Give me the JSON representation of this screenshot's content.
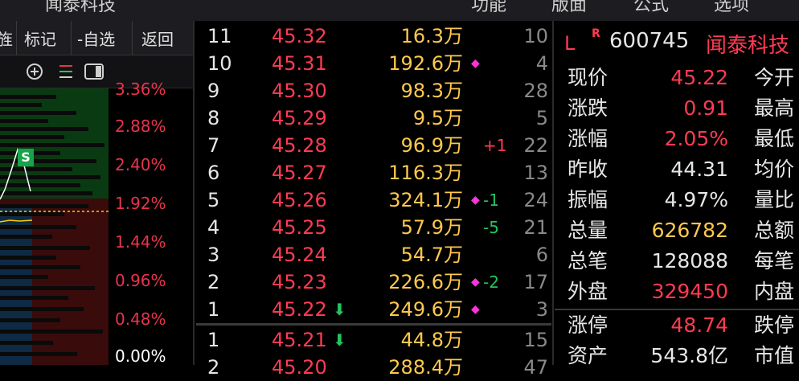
{
  "window": {
    "title": "闻泰科技",
    "menu": [
      "功能",
      "版面",
      "公式",
      "选项"
    ]
  },
  "toolbar": {
    "items": [
      "旌",
      "标记",
      "-自选",
      "返回"
    ]
  },
  "chart": {
    "signal_label": "S",
    "percent_ticks": [
      "3.36%",
      "2.88%",
      "2.40%",
      "1.92%",
      "1.44%",
      "0.96%",
      "0.48%",
      "0.00%"
    ]
  },
  "order_book": {
    "asks": [
      {
        "level": "11",
        "price": "45.32",
        "volume": "16.3万",
        "change": "",
        "count": "10",
        "marker": false,
        "arrow": false
      },
      {
        "level": "10",
        "price": "45.31",
        "volume": "192.6万",
        "change": "",
        "count": "4",
        "marker": true,
        "arrow": false
      },
      {
        "level": "9",
        "price": "45.30",
        "volume": "98.3万",
        "change": "",
        "count": "28",
        "marker": false,
        "arrow": false
      },
      {
        "level": "8",
        "price": "45.29",
        "volume": "9.5万",
        "change": "",
        "count": "5",
        "marker": false,
        "arrow": false
      },
      {
        "level": "7",
        "price": "45.28",
        "volume": "96.9万",
        "change": "+1",
        "count": "22",
        "marker": false,
        "arrow": false
      },
      {
        "level": "6",
        "price": "45.27",
        "volume": "116.3万",
        "change": "",
        "count": "13",
        "marker": false,
        "arrow": false
      },
      {
        "level": "5",
        "price": "45.26",
        "volume": "324.1万",
        "change": "-1",
        "count": "24",
        "marker": true,
        "arrow": false
      },
      {
        "level": "4",
        "price": "45.25",
        "volume": "57.9万",
        "change": "-5",
        "count": "21",
        "marker": false,
        "arrow": false
      },
      {
        "level": "3",
        "price": "45.24",
        "volume": "54.7万",
        "change": "",
        "count": "6",
        "marker": false,
        "arrow": false
      },
      {
        "level": "2",
        "price": "45.23",
        "volume": "226.6万",
        "change": "-2",
        "count": "17",
        "marker": true,
        "arrow": false
      },
      {
        "level": "1",
        "price": "45.22",
        "volume": "249.6万",
        "change": "",
        "count": "3",
        "marker": true,
        "arrow": true
      }
    ],
    "bids": [
      {
        "level": "1",
        "price": "45.21",
        "volume": "44.8万",
        "change": "",
        "count": "15",
        "marker": false,
        "arrow": true
      },
      {
        "level": "2",
        "price": "45.20",
        "volume": "288.4万",
        "change": "",
        "count": "47",
        "marker": false,
        "arrow": false
      }
    ],
    "colors": {
      "price": "#ff3b52",
      "volume": "#ffc94d",
      "marker": "#ff33d8",
      "down": "#22c55e"
    }
  },
  "quote": {
    "badge_l": "L",
    "badge_r": "R",
    "code": "600745",
    "name": "闻泰科技",
    "rows": [
      {
        "label": "现价",
        "value": "45.22",
        "color": "red",
        "label2": "今开"
      },
      {
        "label": "涨跌",
        "value": "0.91",
        "color": "red",
        "label2": "最高"
      },
      {
        "label": "涨幅",
        "value": "2.05%",
        "color": "red",
        "label2": "最低"
      },
      {
        "label": "昨收",
        "value": "44.31",
        "color": "white",
        "label2": "均价"
      },
      {
        "label": "振幅",
        "value": "4.97%",
        "color": "white",
        "label2": "量比"
      },
      {
        "label": "总量",
        "value": "626782",
        "color": "yellow",
        "label2": "总额"
      },
      {
        "label": "总笔",
        "value": "128088",
        "color": "white",
        "label2": "每笔"
      },
      {
        "label": "外盘",
        "value": "329450",
        "color": "red",
        "label2": "内盘"
      }
    ],
    "rows2": [
      {
        "label": "涨停",
        "value": "48.74",
        "color": "red",
        "label2": "跌停"
      },
      {
        "label": "资产",
        "value": "543.8亿",
        "color": "white",
        "label2": "市值"
      }
    ]
  }
}
